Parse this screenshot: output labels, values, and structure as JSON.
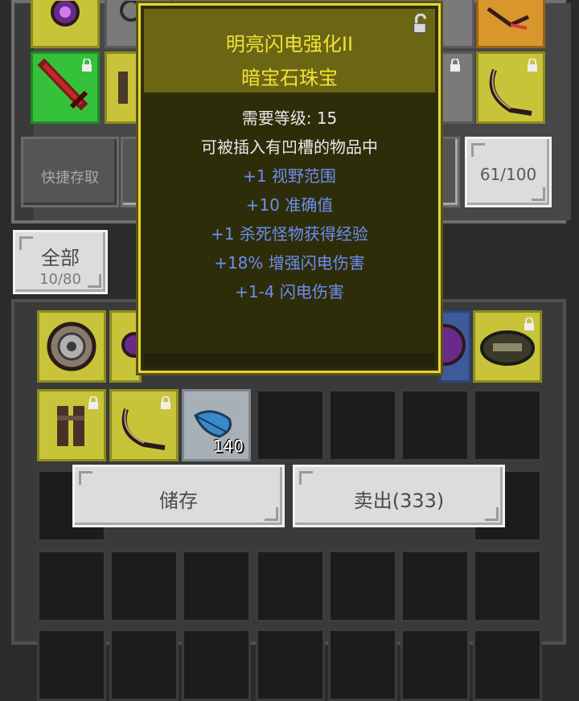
{
  "equipment": {
    "quick_store_label": "快捷存取",
    "capacity": "61/100"
  },
  "filter": {
    "label": "全部",
    "count": "10/80"
  },
  "inventory": {
    "feather_count": "140"
  },
  "tooltip": {
    "title": "明亮闪电强化II",
    "subtitle": "暗宝石珠宝",
    "lines": [
      {
        "text": "需要等级: 15",
        "kind": "requirement"
      },
      {
        "text": "可被插入有凹槽的物品中",
        "kind": "requirement"
      },
      {
        "text": "+1 视野范围",
        "kind": "stat"
      },
      {
        "text": "+10 准确值",
        "kind": "stat"
      },
      {
        "text": "+1 杀死怪物获得经验",
        "kind": "stat"
      },
      {
        "text": "+18% 增强闪电伤害",
        "kind": "stat"
      },
      {
        "text": "+1-4 闪电伤害",
        "kind": "stat"
      }
    ]
  },
  "actions": {
    "store_label": "储存",
    "sell_label": "卖出(333)"
  },
  "colors": {
    "tooltip_title": "#f1e23a",
    "stat_blue": "#6d8ef0",
    "tooltip_border": "#e6d53a",
    "slot_yellow": "#c8c43a",
    "slot_green": "#35c13a"
  }
}
